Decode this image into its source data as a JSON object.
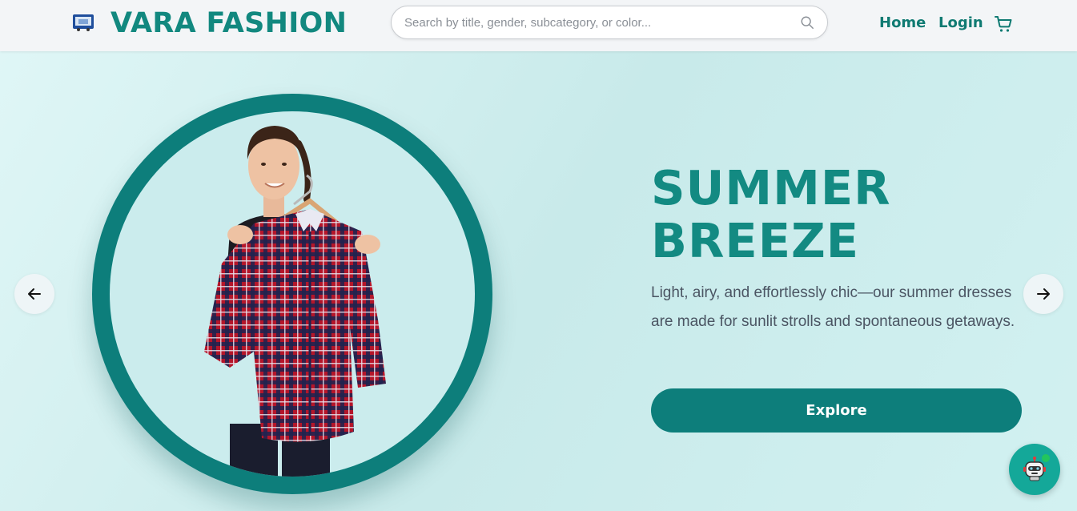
{
  "header": {
    "brand": "VARA FASHION",
    "logo_icon": "shopping-cart-logo-icon",
    "search": {
      "placeholder": "Search by title, gender, subcategory, or color...",
      "value": "",
      "icon": "search-icon"
    },
    "nav": {
      "home": "Home",
      "login": "Login",
      "cart_icon": "cart-icon"
    }
  },
  "hero": {
    "title_line1": "SUMMER",
    "title_line2": "BREEZE",
    "description": "Light, airy, and effortlessly chic—our summer dresses are made for sunlit strolls and spontaneous getaways.",
    "cta_label": "Explore",
    "prev_icon": "arrow-left-icon",
    "next_icon": "arrow-right-icon",
    "image": "woman-holding-plaid-shirt"
  },
  "chat_widget": {
    "icon": "robot-icon",
    "status": "online"
  },
  "colors": {
    "accent": "#0d7e7b",
    "brand_text": "#12887f",
    "hero_bg": "#c8eaea",
    "header_bg": "#f3f5f7",
    "online": "#22c55e"
  }
}
